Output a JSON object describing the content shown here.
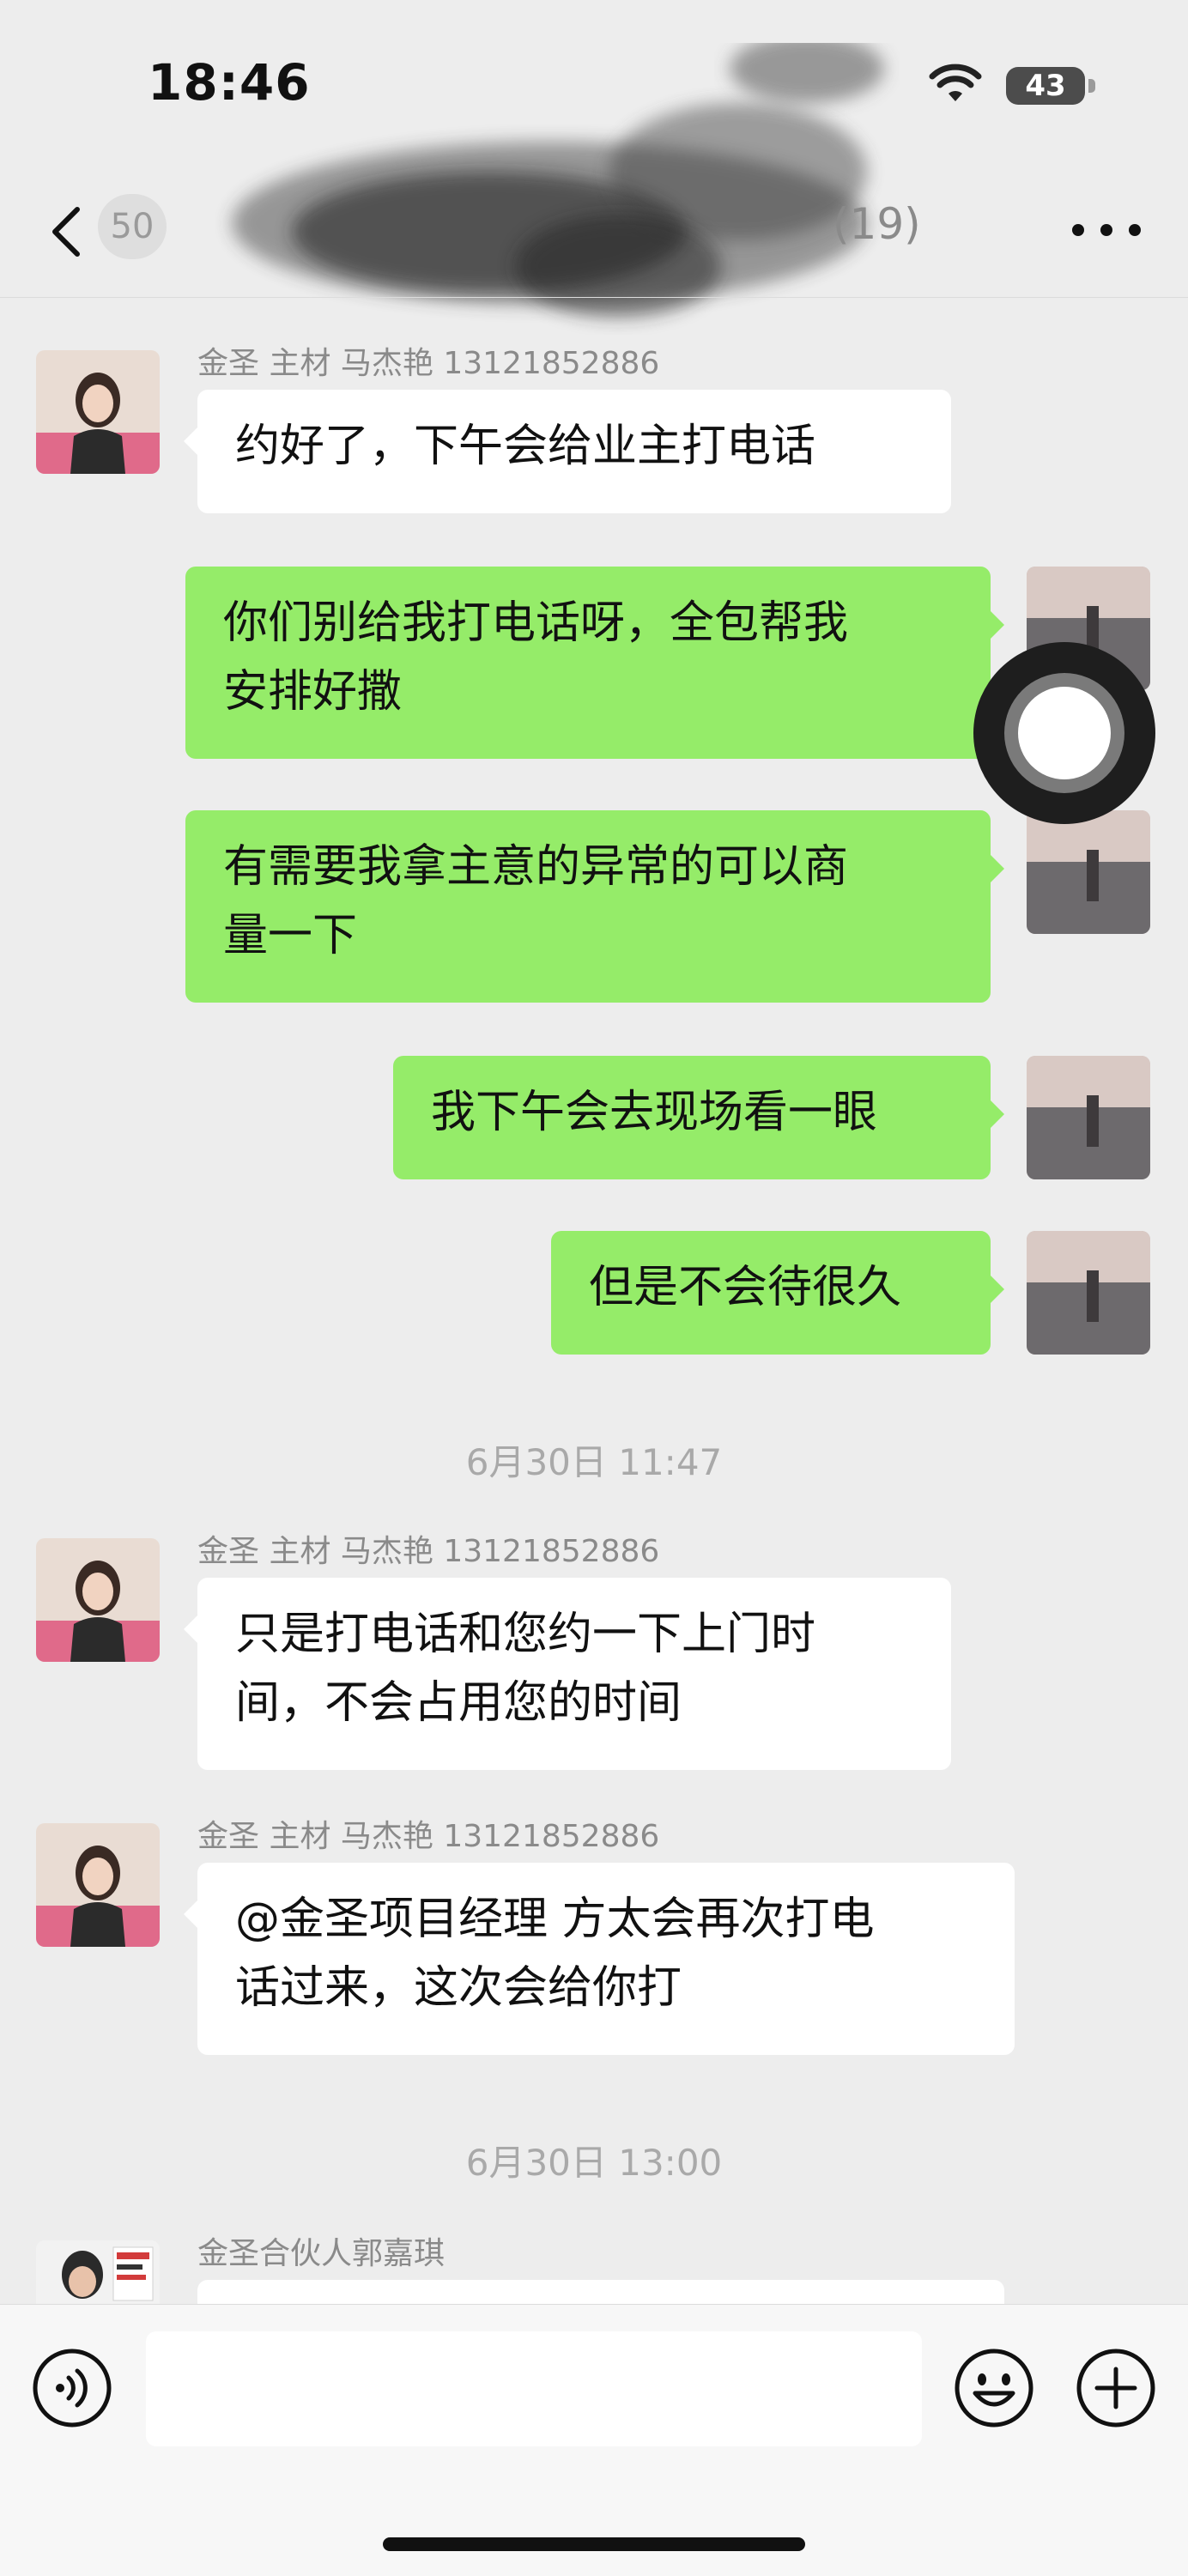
{
  "status_bar": {
    "time": "18:46",
    "battery": "43"
  },
  "nav": {
    "back_count": "50",
    "title_count": "(19)"
  },
  "messages": [
    {
      "sender": "金圣 主材 马杰艳 13121852886",
      "lines": [
        "约好了，下午会给业主打电话"
      ]
    },
    {
      "lines": [
        "你们别给我打电话呀，全包帮我",
        "安排好撒"
      ]
    },
    {
      "lines": [
        "有需要我拿主意的异常的可以商",
        "量一下"
      ]
    },
    {
      "lines": [
        "我下午会去现场看一眼"
      ]
    },
    {
      "lines": [
        "但是不会待很久"
      ]
    },
    {
      "timestamp": "6月30日 11:47"
    },
    {
      "sender": "金圣 主材 马杰艳 13121852886",
      "lines": [
        "只是打电话和您约一下上门时",
        "间，不会占用您的时间"
      ]
    },
    {
      "sender": "金圣 主材 马杰艳 13121852886",
      "lines": [
        "@金圣项目经理 方太会再次打电",
        "话过来，这次会给你打"
      ]
    },
    {
      "timestamp": "6月30日 13:00"
    },
    {
      "sender": "金圣合伙人郭嘉琪"
    }
  ],
  "input": {
    "value": ""
  },
  "icons": {
    "back": "chevron-left-icon",
    "more": "more-icon",
    "voice": "voice-icon",
    "emoji": "emoji-icon",
    "plus": "plus-icon",
    "wifi": "wifi-icon",
    "battery": "battery-icon"
  },
  "colors": {
    "background": "#ededed",
    "outgoing_bubble": "#95ec69",
    "incoming_bubble": "#ffffff",
    "timestamp": "#a9a9a9"
  }
}
